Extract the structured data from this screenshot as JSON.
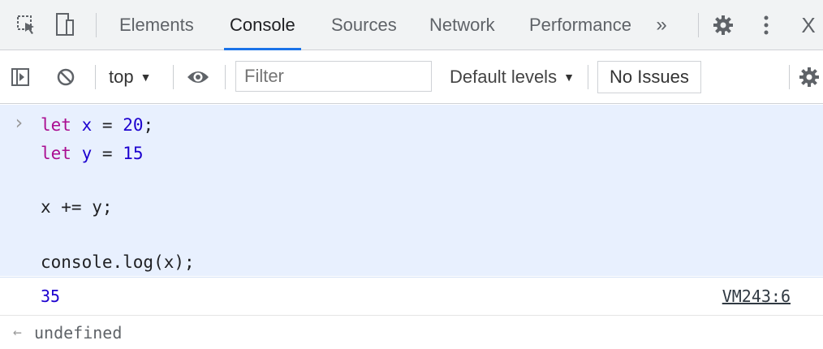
{
  "tabbar": {
    "icons": [
      "inspect-element-icon",
      "device-toolbar-icon"
    ],
    "tabs": [
      {
        "label": "Elements"
      },
      {
        "label": "Console"
      },
      {
        "label": "Sources"
      },
      {
        "label": "Network"
      },
      {
        "label": "Performance"
      }
    ],
    "active_tab": "Console",
    "more_label": "»",
    "close_label": "X"
  },
  "toolbar": {
    "context": "top",
    "filter_placeholder": "Filter",
    "levels": "Default levels",
    "issues": "No Issues"
  },
  "console": {
    "prompt": "›",
    "lines": [
      {
        "kw": "let",
        "var": "x",
        "op": "=",
        "num": "20",
        "end": ";"
      },
      {
        "kw": "let",
        "var": "y",
        "op": "=",
        "num": "15",
        "end": ""
      },
      {
        "text": "x += y;"
      },
      {
        "text": "console.log(x);"
      }
    ],
    "output": {
      "value": "35",
      "source": "VM243:6"
    },
    "result": {
      "arrow": "←",
      "value": "undefined"
    }
  },
  "colors": {
    "accent": "#1a73e8",
    "input_bg": "#e8f0fe",
    "keyword": "#aa0d91",
    "number": "#1c00cf"
  }
}
